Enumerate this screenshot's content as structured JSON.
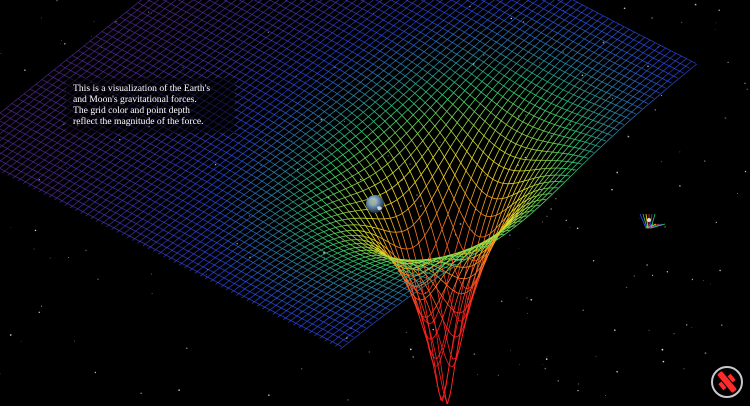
{
  "info_text": "This is a visualization of the Earth's\nand Moon's gravitational forces.\nThe grid color and point depth\nreflect the magnitude of the force.",
  "scene": {
    "background": "#000000",
    "grid_colors": {
      "far_field": "#7a2aa0",
      "weak": "#3050ff",
      "medium": "#30d070",
      "strong": "#f0e020",
      "strongest": "#ff2020"
    },
    "bodies": [
      {
        "name": "earth-icon"
      },
      {
        "name": "moon-icon"
      }
    ]
  },
  "controls": {
    "compass_icon": "satellite-compass-icon",
    "compass_colors": {
      "ring": "#c8c8d0",
      "needle": "#ff2a2a"
    }
  }
}
